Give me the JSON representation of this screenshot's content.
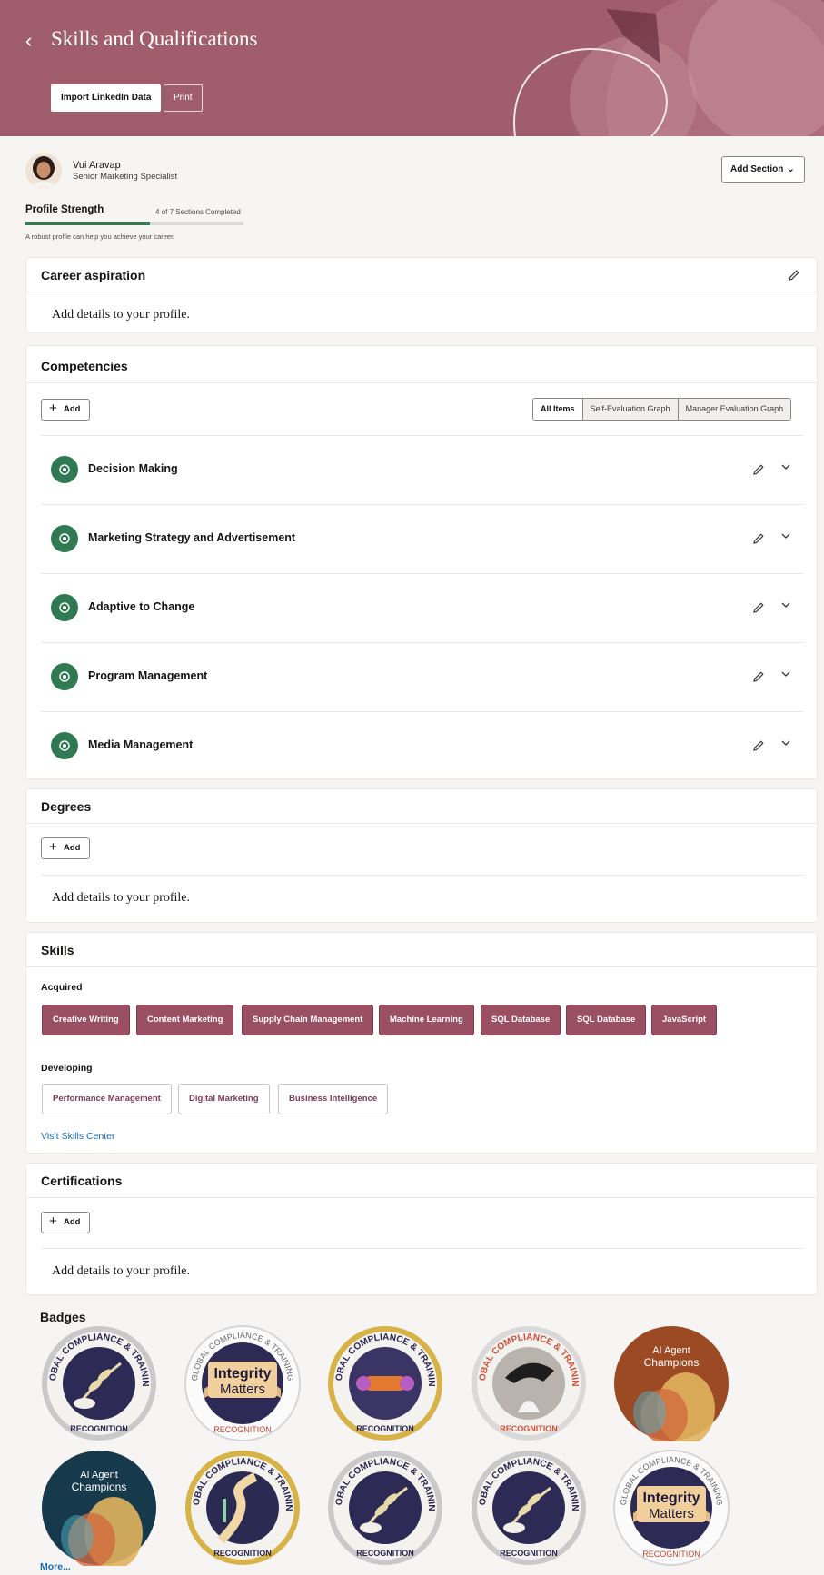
{
  "header": {
    "title": "Skills and Qualifications",
    "import_label": "Import LinkedIn Data",
    "print_label": "Print"
  },
  "profile": {
    "name": "Vui Aravap",
    "role": "Senior Marketing Specialist",
    "add_section_label": "Add Section",
    "strength_label": "Profile Strength",
    "strength_count": "4 of 7 Sections Completed",
    "strength_fraction": 0.571,
    "strength_hint": "A robust profile can help you achieve your career."
  },
  "career": {
    "title": "Career aspiration",
    "empty": "Add details to your profile."
  },
  "competencies": {
    "title": "Competencies",
    "add_label": "Add",
    "views": [
      "All Items",
      "Self-Evaluation Graph",
      "Manager Evaluation Graph"
    ],
    "items": [
      "Decision Making",
      "Marketing Strategy and Advertisement",
      "Adaptive to Change",
      "Program Management",
      "Media Management"
    ]
  },
  "degrees": {
    "title": "Degrees",
    "add_label": "Add",
    "empty": "Add details to your profile."
  },
  "skills": {
    "title": "Skills",
    "acquired_label": "Acquired",
    "acquired": [
      "Creative Writing",
      "Content Marketing",
      "Supply Chain Management",
      "Machine Learning",
      "SQL Database",
      "SQL Database",
      "JavaScript"
    ],
    "developing_label": "Developing",
    "developing": [
      "Performance Management",
      "Digital Marketing",
      "Business Intelligence"
    ],
    "visit_link": "Visit Skills Center"
  },
  "certifications": {
    "title": "Certifications",
    "add_label": "Add",
    "empty": "Add details to your profile."
  },
  "badges": {
    "title": "Badges",
    "more_link": "More...",
    "ring_top": "GLOBAL COMPLIANCE & TRAINING",
    "ring_bottom": "RECOGNITION",
    "integrity_line1": "Integrity",
    "integrity_line2": "Matters",
    "ai_line1": "AI Agent",
    "ai_line2": "Champions"
  },
  "colors": {
    "brand": "#a05d6c",
    "acquired_chip": "#9a4f63",
    "competency_icon": "#2f7a52",
    "link": "#1a6db5"
  }
}
